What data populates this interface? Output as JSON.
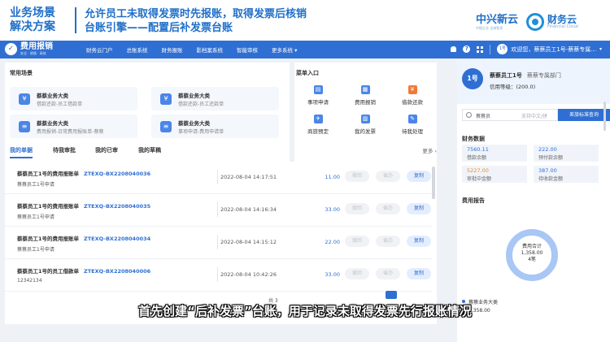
{
  "slide": {
    "scene_line1": "业务场景",
    "scene_line2": "解决方案",
    "headline_line1": "允许员工未取得发票时先报账，取得发票后核销",
    "headline_line2": "台账引擎——配置后补发票台账"
  },
  "brand": {
    "zx_name": "中兴新云",
    "zx_tagline": "中国企业 全球智享",
    "fc_name": "财务云",
    "fc_en": "Financial Cloud"
  },
  "navbar": {
    "logo_text": "费用报销",
    "logo_sub": "安全 · 便捷 · 高效",
    "items": [
      "财务云门户",
      "总账系统",
      "财务报账",
      "影档案系统",
      "智能审核",
      "更多系统 ▾"
    ],
    "user_avatar": "1号",
    "user_text": "欢迎您，蔡蔡员工1号-蔡蔡专属..."
  },
  "common_scenes": {
    "title": "常用场景",
    "cards": [
      {
        "title": "蔡蔡业务大类",
        "sub": "借款还款-员工借款单",
        "icon": "wallet-icon"
      },
      {
        "title": "蔡蔡业务大类",
        "sub": "借款还款-员工还款单",
        "icon": "wallet-icon"
      },
      {
        "title": "蔡蔡业务大类",
        "sub": "费用报销-日常费用报账单-蔡蔡",
        "icon": "receipt-icon"
      },
      {
        "title": "蔡蔡业务大类",
        "sub": "事项申请-费用申请单",
        "icon": "receipt-icon"
      }
    ]
  },
  "menu_entry": {
    "title": "菜单入口",
    "items": [
      "事项申请",
      "费用报销",
      "借款还款",
      "商旅预定",
      "我的发票",
      "待我处理"
    ]
  },
  "tabs": {
    "items": [
      "我的单据",
      "待我审批",
      "我的已审",
      "我的草稿"
    ],
    "more": "更多 ›"
  },
  "documents": [
    {
      "title": "蔡蔡员工1号的费用报账单",
      "code": "ZTEXQ-BX2208040036",
      "sub": "蔡蔡员工1号申请",
      "time": "2022-08-04 14:17:51",
      "amount": "11.00"
    },
    {
      "title": "蔡蔡员工1号的费用报账单",
      "code": "ZTEXQ-BX2208040035",
      "sub": "蔡蔡员工1号申请",
      "time": "2022-08-04 14:16:34",
      "amount": "33.00"
    },
    {
      "title": "蔡蔡员工1号的费用报账单",
      "code": "ZTEXQ-BX2208040034",
      "sub": "蔡蔡员工1号申请",
      "time": "2022-08-04 14:15:12",
      "amount": "22.00"
    },
    {
      "title": "蔡蔡员工1号的员工借款单",
      "code": "ZTEXQ-BX2208040006",
      "sub": "12342134",
      "time": "2022-08-04 10:42:26",
      "amount": "33.00"
    }
  ],
  "row_buttons": {
    "recall": "撤回",
    "urge": "催办",
    "copy": "复制"
  },
  "pager": {
    "text": "共 3"
  },
  "user_card": {
    "avatar": "1号",
    "name": "蔡蔡员工1号",
    "dept": "蔡蔡专属部门",
    "credit": "信用等级：(200.0)"
  },
  "search": {
    "value": "蔡蔡员",
    "placeholder": "支持中文/拼",
    "button": "差旅标准查询"
  },
  "finance": {
    "title": "财务数据",
    "cards": [
      {
        "value": "7560.11",
        "label": "借款余额",
        "warn": false
      },
      {
        "value": "222.00",
        "label": "预付款余额",
        "warn": false
      },
      {
        "value": "5227.00",
        "label": "审批中金额",
        "warn": true
      },
      {
        "value": "387.00",
        "label": "待收款金额",
        "warn": false
      }
    ]
  },
  "expense_report": {
    "title": "费用报告",
    "center_label": "费用合计",
    "center_amount": "1,358.00",
    "center_count": "4笔",
    "legend_label": "蔡蔡业务大类",
    "legend_value": "1,358.00",
    "accent": "#a9c7f5"
  },
  "subtitle": "首先创建“后补发票”台账，用于记录未取得发票先行报账情况"
}
